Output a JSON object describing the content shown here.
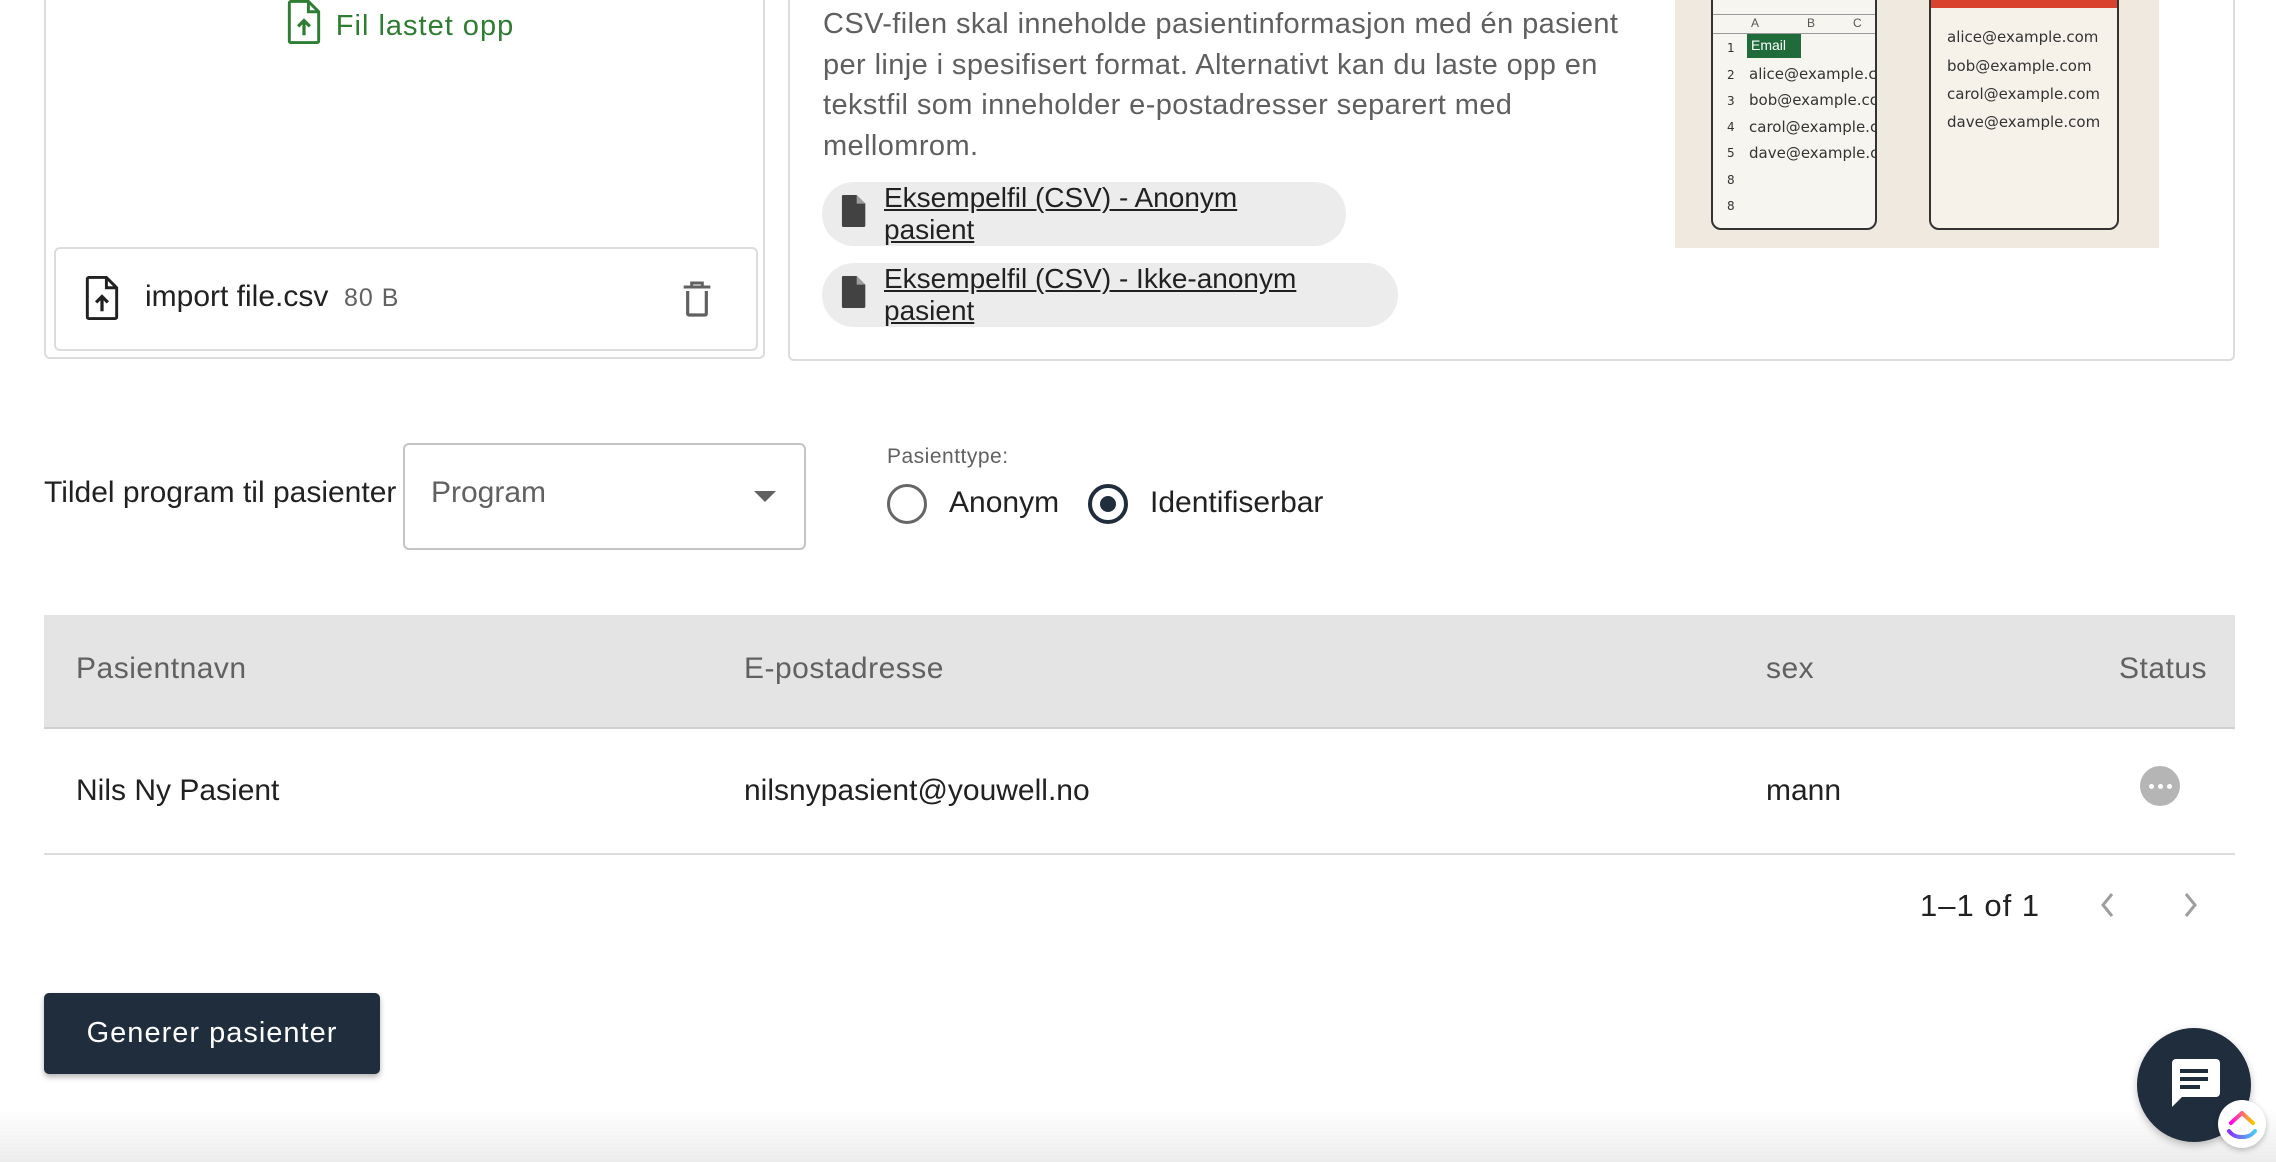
{
  "upload": {
    "status_label": "Fil lastet opp",
    "file_name": "import file.csv",
    "file_size": "80 B"
  },
  "info": {
    "text": "CSV-filen skal inneholde pasientinformasjon med én pasient per linje i spesifisert format. Alternativt kan du laste opp en tekstfil som inneholder e-postadresser separert med mellomrom.",
    "example_anon": "Eksempelfil (CSV) - Anonym pasient",
    "example_ident": "Eksempelfil (CSV) - Ikke-anonym pasient"
  },
  "illustration": {
    "col_a": "A",
    "col_b": "B",
    "col_c": "C",
    "header_cell": "Email",
    "row_nums": [
      "1",
      "2",
      "3",
      "4",
      "5",
      "8",
      "8"
    ],
    "emails": [
      "alice@example.com",
      "bob@example.com",
      "carol@example.com",
      "dave@example.com"
    ]
  },
  "program": {
    "label": "Tildel program til pasienter",
    "select_value": "Program"
  },
  "patient_type": {
    "label": "Pasienttype:",
    "options": [
      "Anonym",
      "Identifiserbar"
    ],
    "selected": "Identifiserbar"
  },
  "table": {
    "headers": [
      "Pasientnavn",
      "E-postadresse",
      "sex",
      "Status"
    ],
    "rows": [
      {
        "name": "Nils Ny Pasient",
        "email": "nilsnypasient@youwell.no",
        "sex": "mann"
      }
    ]
  },
  "pagination": {
    "text": "1–1 of 1"
  },
  "actions": {
    "generate_label": "Generer pasienter"
  },
  "colors": {
    "primary": "#1f2d3d",
    "success": "#2e7d32"
  }
}
